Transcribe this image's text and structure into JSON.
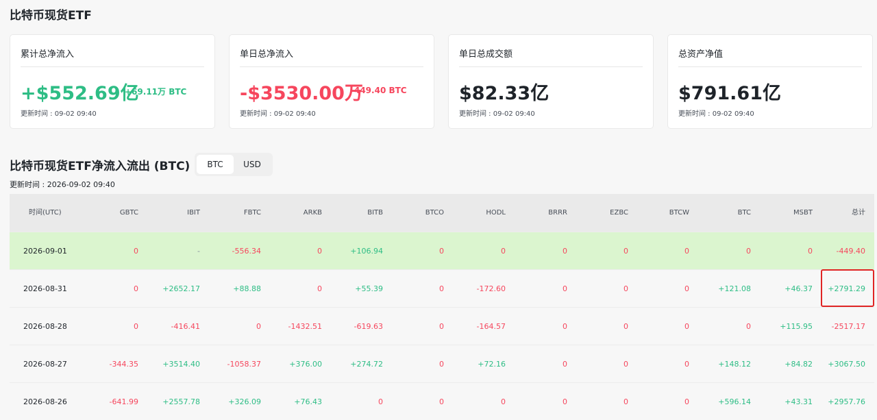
{
  "page_title": "比特币现货ETF",
  "cards": [
    {
      "label": "累计总净流入",
      "value": "+$552.69亿",
      "sub": "+69.11万 BTC",
      "time": "更新时间 : 09-02 09:40"
    },
    {
      "label": "单日总净流入",
      "value": "-$3530.00万",
      "sub": "-449.40 BTC",
      "time": "更新时间 : 09-02 09:40"
    },
    {
      "label": "单日总成交额",
      "value": "$82.33亿",
      "sub": "",
      "time": "更新时间 : 09-02 09:40"
    },
    {
      "label": "总资产净值",
      "value": "$791.61亿",
      "sub": "",
      "time": "更新时间 : 09-02 09:40"
    }
  ],
  "flow": {
    "title": "比特币现货ETF净流入流出 (BTC)",
    "toggle": {
      "btc": "BTC",
      "usd": "USD",
      "selected": "BTC"
    },
    "updated": "更新时间 : 2026-09-02 09:40"
  },
  "table": {
    "headers": [
      "时间(UTC)",
      "GBTC",
      "IBIT",
      "FBTC",
      "ARKB",
      "BITB",
      "BTCO",
      "HODL",
      "BRRR",
      "EZBC",
      "BTCW",
      "BTC",
      "MSBT",
      "总计"
    ],
    "rows": [
      [
        "2026-09-01",
        "0",
        "-",
        "-556.34",
        "0",
        "+106.94",
        "0",
        "0",
        "0",
        "0",
        "0",
        "0",
        "0",
        "-449.40"
      ],
      [
        "2026-08-31",
        "0",
        "+2652.17",
        "+88.88",
        "0",
        "+55.39",
        "0",
        "-172.60",
        "0",
        "0",
        "0",
        "+121.08",
        "+46.37",
        "+2791.29"
      ],
      [
        "2026-08-28",
        "0",
        "-416.41",
        "0",
        "-1432.51",
        "-619.63",
        "0",
        "-164.57",
        "0",
        "0",
        "0",
        "0",
        "+115.95",
        "-2517.17"
      ],
      [
        "2026-08-27",
        "-344.35",
        "+3514.40",
        "-1058.37",
        "+376.00",
        "+274.72",
        "0",
        "+72.16",
        "0",
        "0",
        "0",
        "+148.12",
        "+84.82",
        "+3067.50"
      ],
      [
        "2026-08-26",
        "-641.99",
        "+2557.78",
        "+326.09",
        "+76.43",
        "0",
        "0",
        "0",
        "0",
        "0",
        "0",
        "+596.14",
        "+43.31",
        "+2957.76"
      ]
    ]
  },
  "colors": {
    "positive": "#2ebd85",
    "negative": "#f6465d",
    "highlight_row": "#dbf5cf",
    "highlight_box": "#e02424"
  }
}
